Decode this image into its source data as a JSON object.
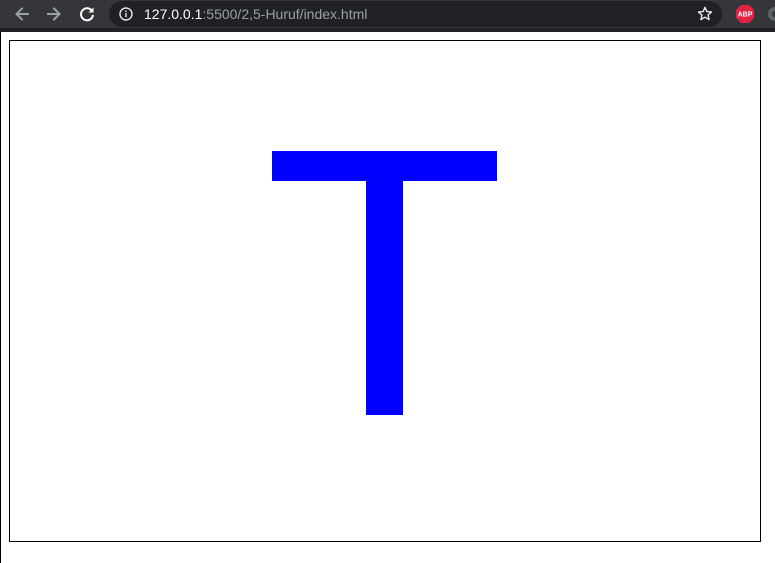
{
  "browser": {
    "url_host": "127.0.0.1",
    "url_rest": ":5500/2,5-Huruf/index.html",
    "extension_label": "ABP"
  },
  "icons": {
    "back": "arrow-left-icon",
    "forward": "arrow-right-icon",
    "reload": "reload-icon",
    "info": "info-icon",
    "bookmark": "star-icon",
    "adblock": "abp-icon"
  },
  "page": {
    "letter_color": "#0000ff",
    "frame_border_color": "#000000",
    "background_color": "#ffffff"
  },
  "colors": {
    "toolbar": "#35363a",
    "omnibox": "#202124",
    "url_host": "#ffffff",
    "url_rest": "#9aa0a6",
    "abp_badge": "#e02446"
  }
}
